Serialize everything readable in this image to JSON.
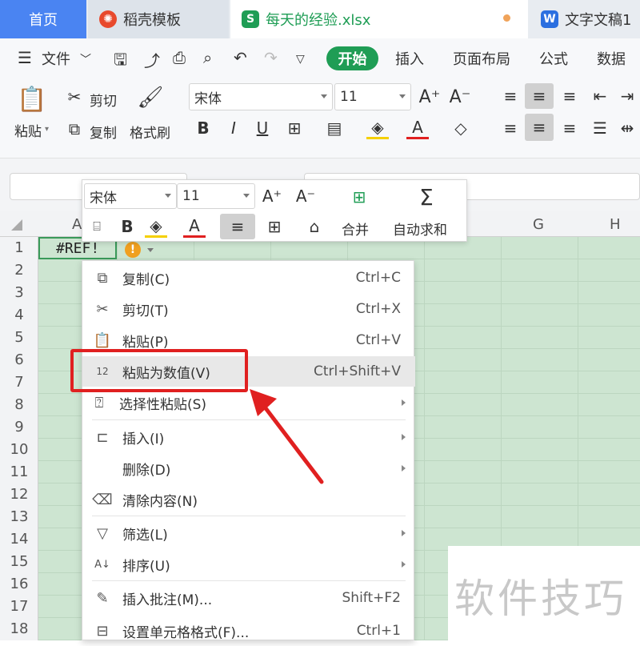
{
  "tabs": [
    {
      "label": "首页",
      "icon": ""
    },
    {
      "label": "稻壳模板",
      "icon": "docer-logo"
    },
    {
      "label": "每天的经验.xlsx",
      "icon": "S"
    },
    {
      "label": "文字文稿1",
      "icon": "W"
    }
  ],
  "menu": {
    "file": "文件",
    "items": [
      "开始",
      "插入",
      "页面布局",
      "公式",
      "数据"
    ]
  },
  "ribbon": {
    "paste": "粘贴",
    "cut": "剪切",
    "copy": "复制",
    "format_painter": "格式刷",
    "font_name": "宋体",
    "font_size": "11"
  },
  "mini_toolbar": {
    "font_name": "宋体",
    "font_size": "11",
    "merge": "合并",
    "autosum": "自动求和"
  },
  "grid": {
    "columns": [
      "A",
      "G",
      "H"
    ],
    "rows": [
      "1",
      "2",
      "3",
      "4",
      "5",
      "6",
      "7",
      "8",
      "9",
      "10",
      "11",
      "12",
      "13",
      "14",
      "15",
      "16",
      "17",
      "18"
    ],
    "cell_a1": "#REF!"
  },
  "context_menu": {
    "items": [
      {
        "label": "复制(C)",
        "shortcut": "Ctrl+C",
        "icon": "copy-icon"
      },
      {
        "label": "剪切(T)",
        "shortcut": "Ctrl+X",
        "icon": "scissors-icon"
      },
      {
        "label": "粘贴(P)",
        "shortcut": "Ctrl+V",
        "icon": "paste-icon"
      },
      {
        "label": "粘贴为数值(V)",
        "shortcut": "Ctrl+Shift+V",
        "icon": "paste-values-icon"
      },
      {
        "label": "选择性粘贴(S)",
        "shortcut": "",
        "icon": "paste-special-icon"
      },
      {
        "label": "插入(I)",
        "shortcut": "",
        "icon": "insert-icon"
      },
      {
        "label": "删除(D)",
        "shortcut": "",
        "icon": ""
      },
      {
        "label": "清除内容(N)",
        "shortcut": "",
        "icon": "eraser-icon"
      },
      {
        "label": "筛选(L)",
        "shortcut": "",
        "icon": "filter-icon"
      },
      {
        "label": "排序(U)",
        "shortcut": "",
        "icon": "sort-icon"
      },
      {
        "label": "插入批注(M)...",
        "shortcut": "Shift+F2",
        "icon": "comment-icon"
      },
      {
        "label": "设置单元格格式(F)...",
        "shortcut": "Ctrl+1",
        "icon": "format-cells-icon"
      }
    ]
  },
  "watermark": "软件技巧",
  "colors": {
    "accent_green": "#1f9d55",
    "home_tab": "#4a84f2",
    "highlight_red": "#e02020",
    "sheet_bg": "#cde5d1"
  }
}
